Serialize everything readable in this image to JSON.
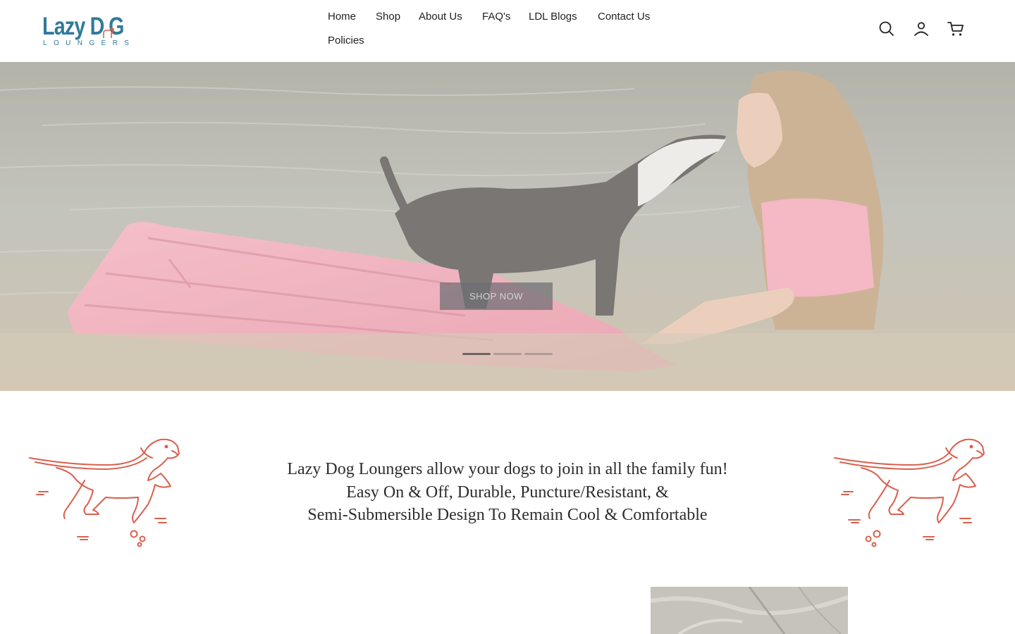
{
  "brand": {
    "logo_main": "Lazy D",
    "logo_letter": "G",
    "logo_sub": "LOUNGERS"
  },
  "nav": {
    "items": [
      "Home",
      "Shop",
      "About Us",
      "FAQ's",
      "LDL Blogs",
      "Contact Us",
      "Policies"
    ]
  },
  "header_icons": [
    "search-icon",
    "account-icon",
    "cart-icon"
  ],
  "hero": {
    "button_label": "SHOP NOW",
    "slides_count": 3,
    "active_slide": 1
  },
  "tagline": {
    "line1": "Lazy Dog Loungers allow your dogs to join in all the family fun!",
    "line2": "Easy On & Off, Durable, Puncture/Resistant, &",
    "line3": "Semi-Submersible Design To Remain Cool & Comfortable"
  },
  "colors": {
    "brand_blue": "#2f7a9b",
    "accent_coral": "#d9604e",
    "lounger_pink": "#e58a9b"
  }
}
